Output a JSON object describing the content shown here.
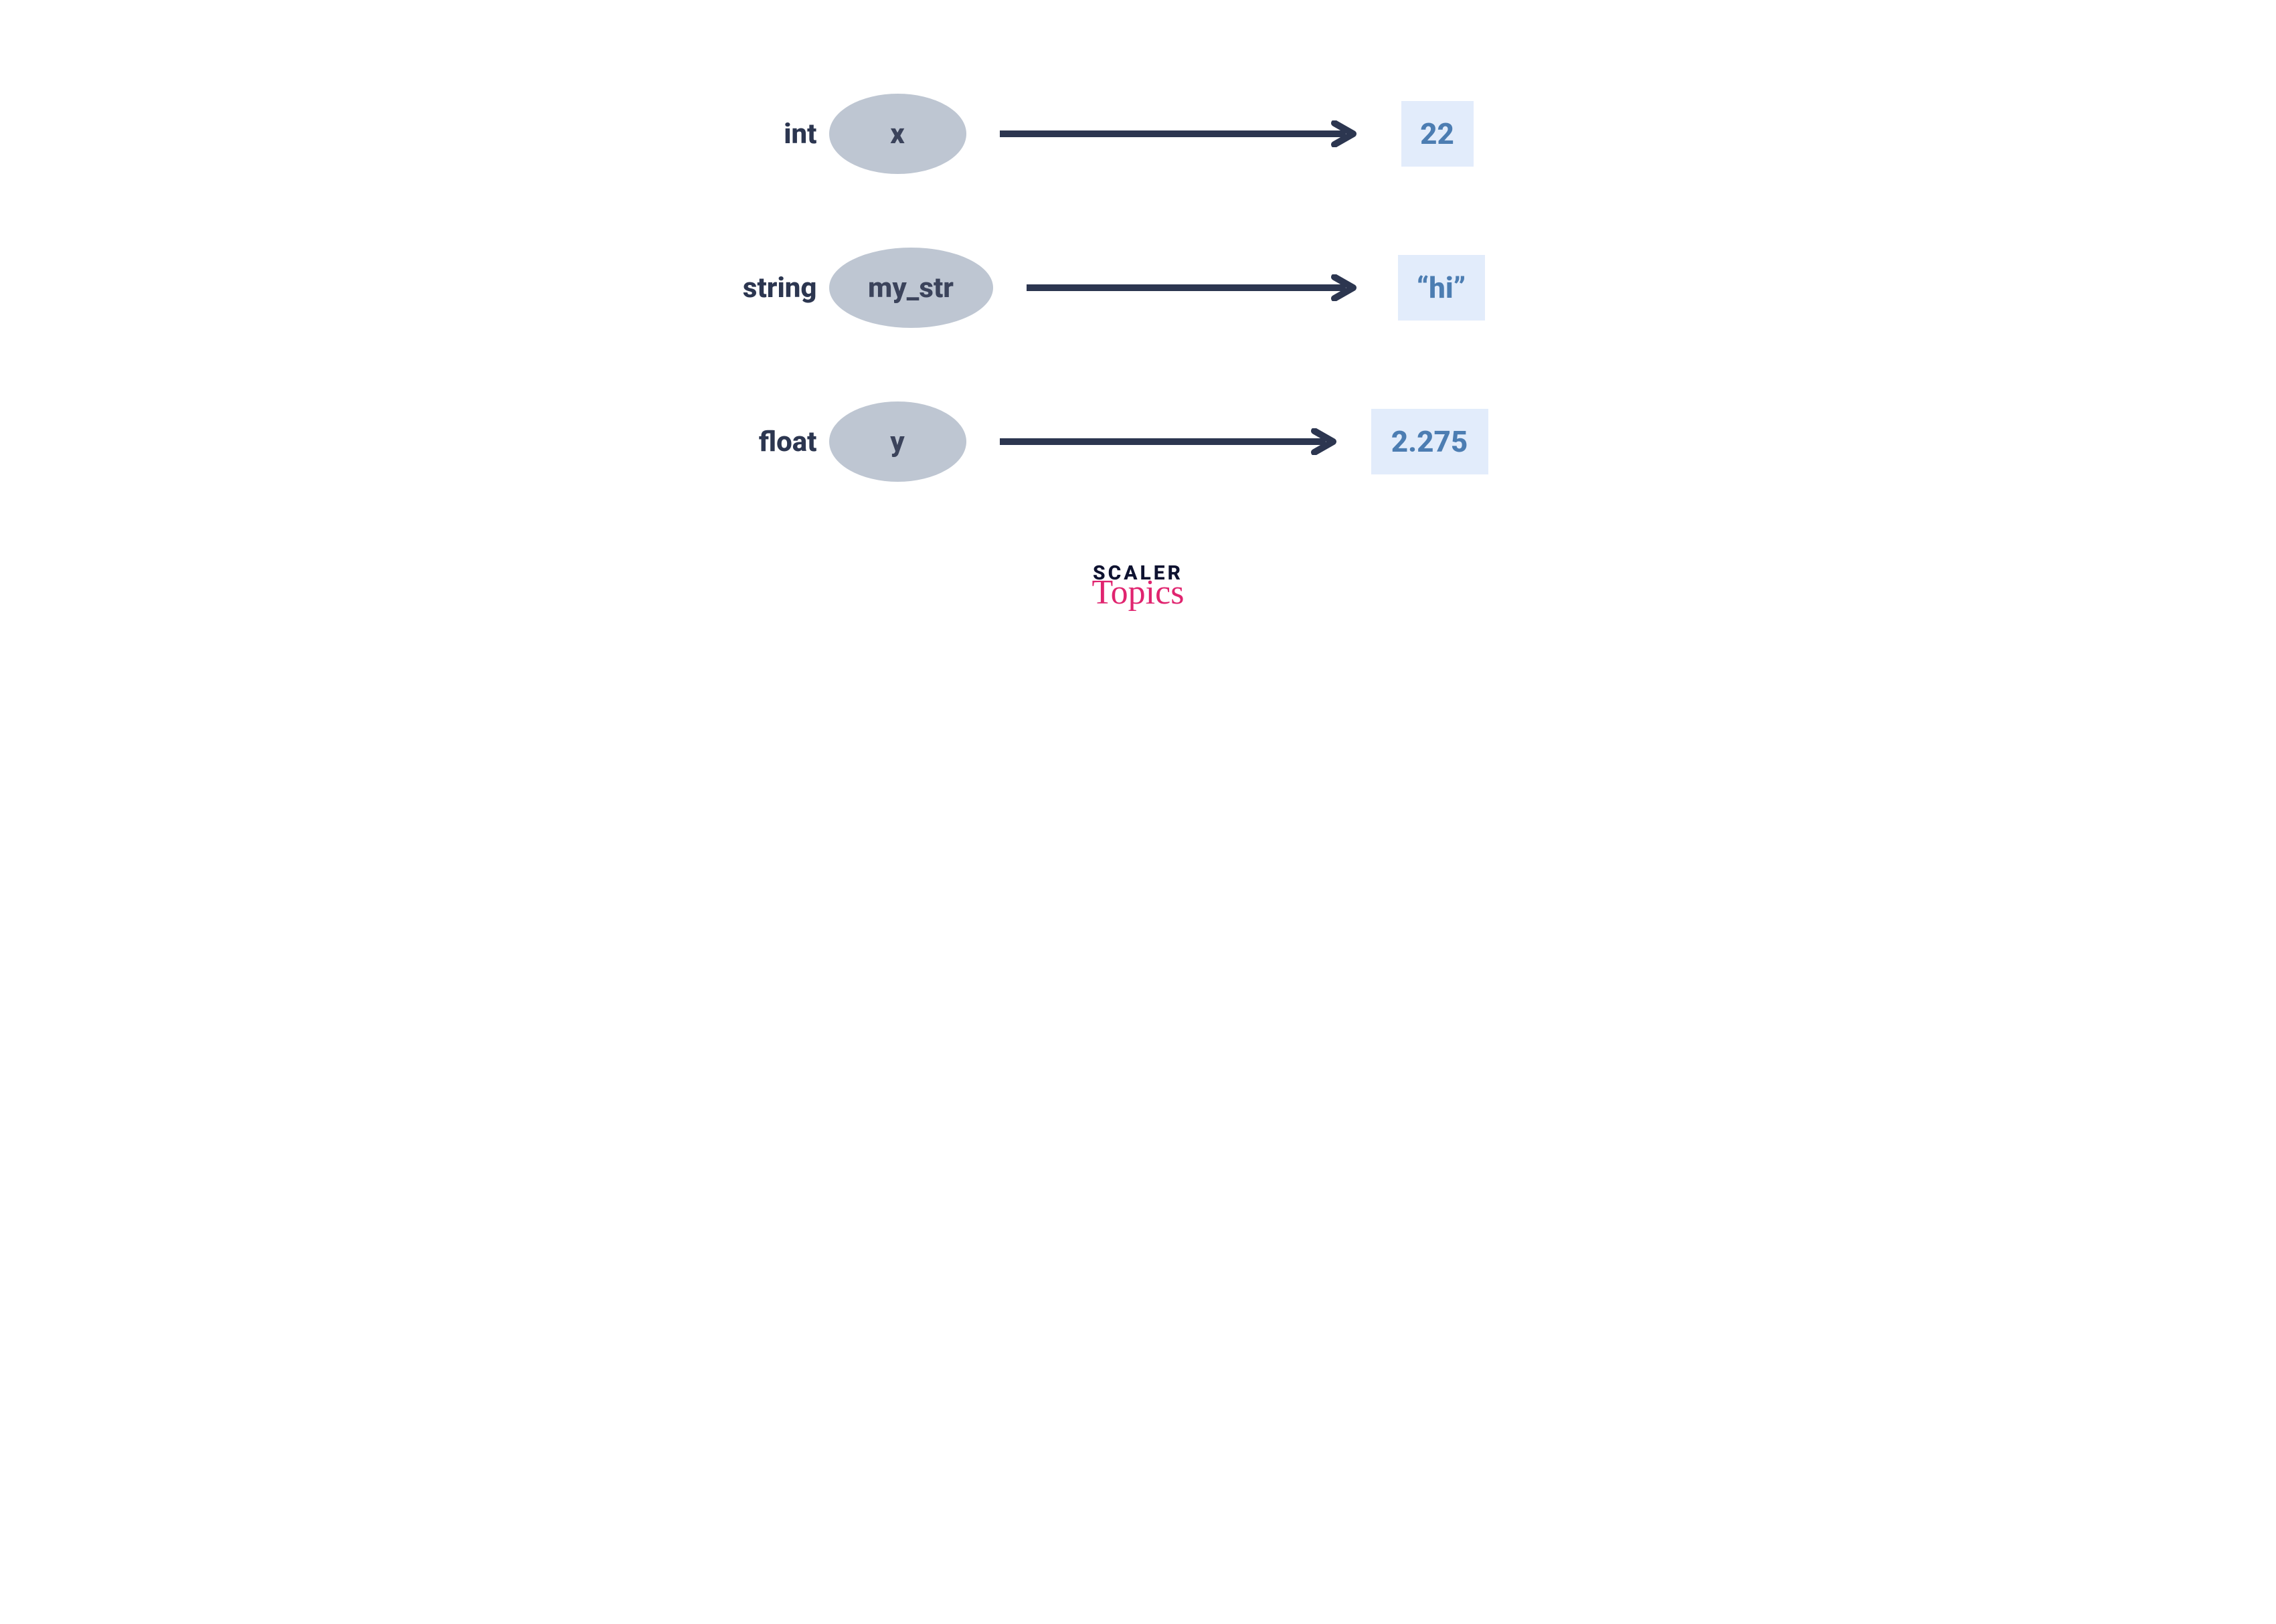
{
  "rows": [
    {
      "type_label": "int",
      "var_name": "x",
      "value": "22"
    },
    {
      "type_label": "string",
      "var_name": "my_str",
      "value": "“hi”"
    },
    {
      "type_label": "float",
      "var_name": "y",
      "value": "2.275"
    }
  ],
  "logo": {
    "line1": "SCALER",
    "line2": "Topics"
  },
  "colors": {
    "label": "#2c3650",
    "ellipse_bg": "#bec6d2",
    "var_name": "#3b435b",
    "arrow": "#2c3650",
    "value_bg": "#e2ecfb",
    "value_text": "#4c7db2",
    "logo_line1": "#0e1230",
    "logo_line2": "#e0246f"
  }
}
